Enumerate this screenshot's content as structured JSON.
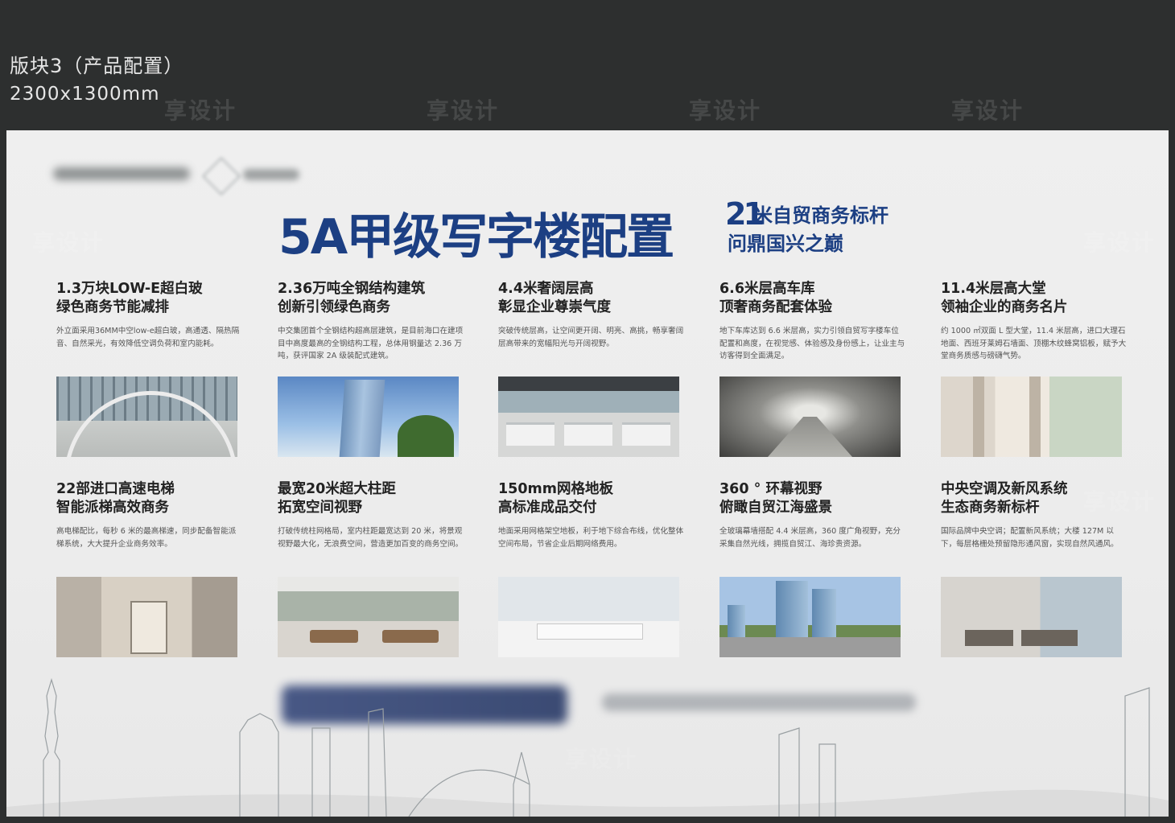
{
  "header": {
    "line1": "版块3（产品配置）",
    "line2": "2300x1300mm"
  },
  "board": {
    "title": "5A甲级写字楼配置",
    "tagline_number": "21",
    "tagline1": "米自贸商务标杆",
    "tagline2": "问鼎国兴之巅",
    "phone_visible": "3292 9000"
  },
  "cards": [
    {
      "heading1": "1.3万块LOW-E超白玻",
      "heading2": "绿色商务节能减排",
      "desc": "外立面采用36MM中空low-e超白玻，高通透、隔热隔音、自然采光，有效降低空调负荷和室内能耗。"
    },
    {
      "heading1": "2.36万吨全钢结构建筑",
      "heading2": "创新引领绿色商务",
      "desc": "中交集团首个全钢结构超高层建筑，是目前海口在建项目中高度最高的全钢结构工程，总体用钢量达 2.36 万吨，获评国家 2A 级装配式建筑。"
    },
    {
      "heading1": "4.4米奢阔层高",
      "heading2": "彰显企业尊崇气度",
      "desc": "突破传统层高，让空间更开阔、明亮、高挑，畅享奢阔层高带来的宽幅阳光与开阔视野。"
    },
    {
      "heading1": "6.6米层高车库",
      "heading2": "顶奢商务配套体验",
      "desc": "地下车库达到 6.6 米层高，实力引领自贸写字楼车位配置和高度，在视觉感、体验感及身份感上，让业主与访客得到全面满足。"
    },
    {
      "heading1": "11.4米层高大堂",
      "heading2": "领袖企业的商务名片",
      "desc": "约 1000 ㎡双面 L 型大堂，11.4 米层高，进口大理石地面、西班牙莱姆石墙面、顶棚木纹蜂窝铝板，赋予大堂商务质感与磅礴气势。"
    },
    {
      "heading1": "22部进口高速电梯",
      "heading2": "智能派梯高效商务",
      "desc": "高电梯配比，每秒 6 米的最高梯速，同步配备智能派梯系统，大大提升企业商务效率。"
    },
    {
      "heading1": "最宽20米超大柱距",
      "heading2": "拓宽空间视野",
      "desc": "打破传统柱网格局，室内柱距最宽达到 20 米，将景观视野最大化，无浪费空间，营造更加百变的商务空间。"
    },
    {
      "heading1": "150mm网格地板",
      "heading2": "高标准成品交付",
      "desc": "地面采用网格架空地板，利于地下综合布线，优化整体空间布局，节省企业后期网络费用。"
    },
    {
      "heading1": "360 ° 环幕视野",
      "heading2": "俯瞰自贸江海盛景",
      "desc": "全玻璃幕墙搭配 4.4 米层高，360 度广角视野，充分采集自然光线，拥揽自贸江、海珍贵资源。"
    },
    {
      "heading1": "中央空调及新风系统",
      "heading2": "生态商务新标杆",
      "desc": "国际品牌中央空调；配置新风系统；大楼 127M 以下，每层格栅处预留隐形通风窗，实现自然风通风。"
    }
  ],
  "watermark": "享设计",
  "colors": {
    "title": "#1c3f83",
    "background": "#2d2f2f",
    "board": "#eeeeee"
  }
}
